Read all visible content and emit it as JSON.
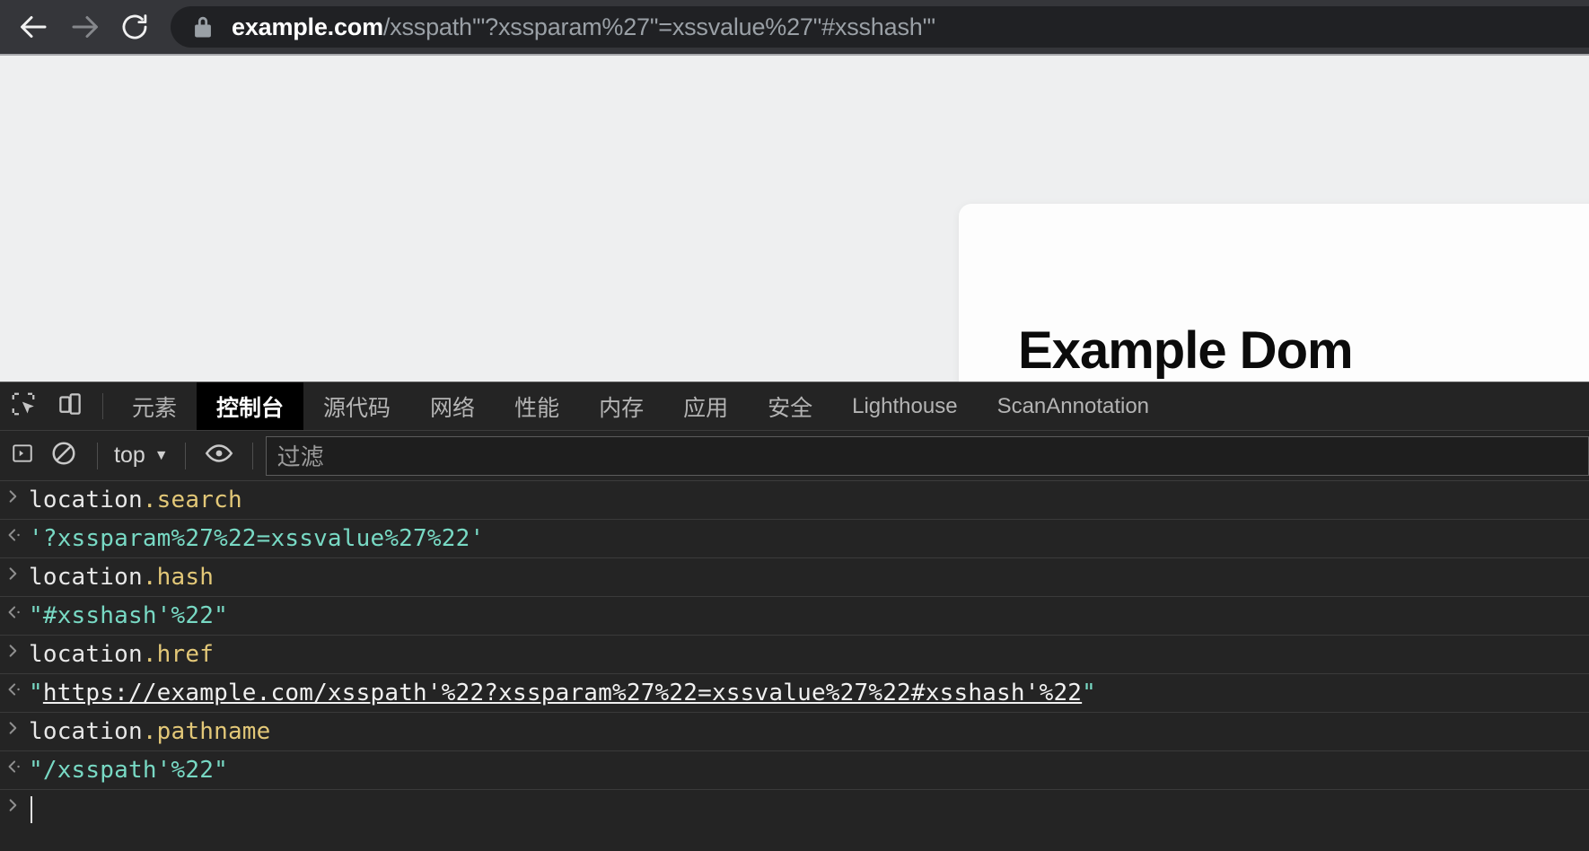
{
  "browser": {
    "back_icon": "back-arrow-icon",
    "forward_icon": "forward-arrow-icon",
    "reload_icon": "reload-icon",
    "lock_icon": "lock-icon",
    "url_host": "example.com",
    "url_rest": "/xsspath'\"?xssparam%27\"=xssvalue%27\"#xsshash'\"",
    "url_full": "example.com/xsspath'\"?xssparam%27\"=xssvalue%27\"#xsshash'\""
  },
  "page": {
    "card_title": "Example Dom"
  },
  "devtools": {
    "inspect_icon": "inspect-element-icon",
    "device_icon": "device-toolbar-icon",
    "tabs": [
      {
        "label": "元素",
        "active": false,
        "latin": false
      },
      {
        "label": "控制台",
        "active": true,
        "latin": false
      },
      {
        "label": "源代码",
        "active": false,
        "latin": false
      },
      {
        "label": "网络",
        "active": false,
        "latin": false
      },
      {
        "label": "性能",
        "active": false,
        "latin": false
      },
      {
        "label": "内存",
        "active": false,
        "latin": false
      },
      {
        "label": "应用",
        "active": false,
        "latin": false
      },
      {
        "label": "安全",
        "active": false,
        "latin": false
      },
      {
        "label": "Lighthouse",
        "active": false,
        "latin": true
      },
      {
        "label": "ScanAnnotation",
        "active": false,
        "latin": true
      }
    ],
    "console_toolbar": {
      "sidebar_icon": "console-sidebar-icon",
      "clear_icon": "clear-console-icon",
      "context": "top",
      "context_caret": "▼",
      "eye_icon": "live-expression-eye-icon",
      "filter_placeholder": "过滤"
    },
    "console_log": [
      {
        "kind": "input",
        "object": "location",
        "prop": ".search"
      },
      {
        "kind": "output",
        "value": "'?xssparam%27%22=xssvalue%27%22'"
      },
      {
        "kind": "input",
        "object": "location",
        "prop": ".hash"
      },
      {
        "kind": "output",
        "value": "\"#xsshash'%22\""
      },
      {
        "kind": "input",
        "object": "location",
        "prop": ".href"
      },
      {
        "kind": "output-link",
        "quote": "\"",
        "link": "https://example.com/xsspath'%22?xssparam%27%22=xssvalue%27%22#xsshash'%22",
        "quote_end": "\""
      },
      {
        "kind": "input",
        "object": "location",
        "prop": ".pathname"
      },
      {
        "kind": "output",
        "value": "\"/xsspath'%22\""
      },
      {
        "kind": "prompt",
        "value": ""
      }
    ]
  },
  "colors": {
    "chrome_bg": "#35363a",
    "omnibox_bg": "#202124",
    "page_bg": "#eeeff0",
    "devtools_bg": "#242424",
    "active_tab_bg": "#000000",
    "string_teal": "#78d9c4",
    "property_gold": "#e3c878"
  }
}
